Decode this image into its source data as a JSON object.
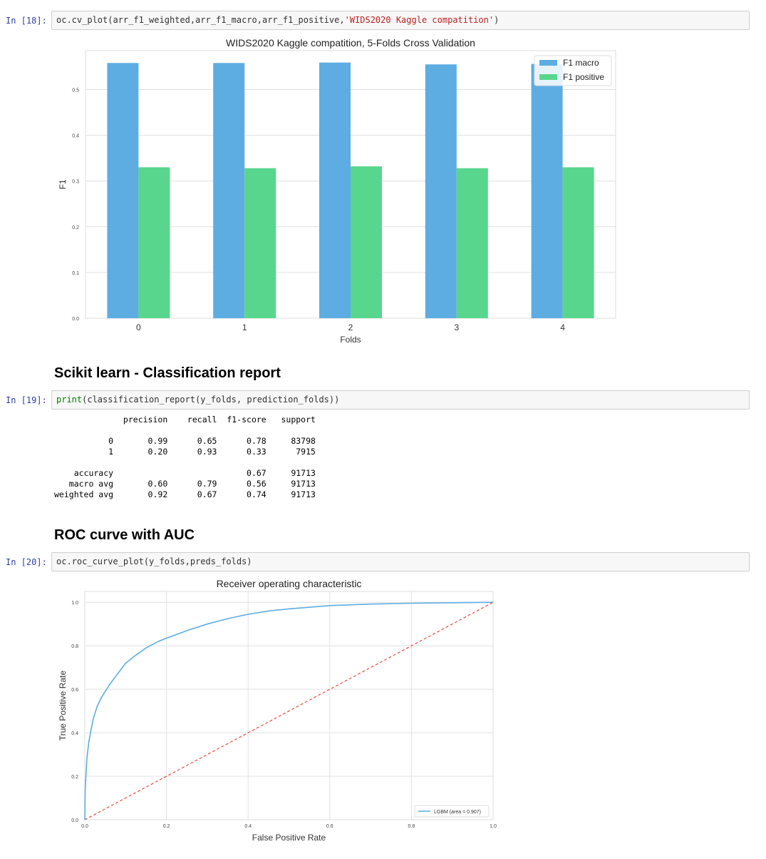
{
  "cells": [
    {
      "prompt": "In [18]:",
      "code_prefix": "oc.cv_plot(arr_f1_weighted,arr_f1_macro,arr_f1_positive,",
      "code_string": "'WIDS2020 Kaggle compatition'",
      "code_suffix": ")"
    },
    {
      "prompt": "In [19]:",
      "code_kw": "print",
      "code_rest": "(classification_report(y_folds, prediction_folds))"
    },
    {
      "prompt": "In [20]:",
      "code": "oc.roc_curve_plot(y_folds,preds_folds)"
    }
  ],
  "headings": {
    "classification": "Scikit learn - Classification report",
    "roc": "ROC curve with AUC"
  },
  "report_text": "              precision    recall  f1-score   support\n\n           0       0.99      0.65      0.78     83798\n           1       0.20      0.93      0.33      7915\n\n    accuracy                           0.67     91713\n   macro avg       0.60      0.79      0.56     91713\nweighted avg       0.92      0.67      0.74     91713",
  "colors": {
    "macro": "#5dade2",
    "positive": "#58d68d",
    "roc": "#5dade2",
    "diag": "#e74c3c",
    "grid": "#e0e0e0"
  },
  "chart_data": [
    {
      "type": "bar",
      "title": "WIDS2020 Kaggle compatition, 5-Folds Cross Validation",
      "xlabel": "Folds",
      "ylabel": "F1",
      "categories": [
        "0",
        "1",
        "2",
        "3",
        "4"
      ],
      "ylim": [
        0,
        0.585
      ],
      "yticks": [
        "0.0",
        "0.1",
        "0.2",
        "0.3",
        "0.4",
        "0.5"
      ],
      "legend": "top-right",
      "grid": true,
      "series": [
        {
          "name": "F1 macro",
          "values": [
            0.558,
            0.558,
            0.559,
            0.555,
            0.556
          ]
        },
        {
          "name": "F1 positive",
          "values": [
            0.33,
            0.328,
            0.332,
            0.328,
            0.33
          ]
        }
      ]
    },
    {
      "type": "line",
      "title": "Receiver operating characteristic",
      "xlabel": "False Positive Rate",
      "ylabel": "True Positive Rate",
      "xlim": [
        0,
        1.0
      ],
      "ylim": [
        0,
        1.05
      ],
      "xticks": [
        "0.0",
        "0.2",
        "0.4",
        "0.6",
        "0.8",
        "1.0"
      ],
      "yticks": [
        "0.0",
        "0.2",
        "0.4",
        "0.6",
        "0.8",
        "1.0"
      ],
      "legend": "bottom-right",
      "grid": true,
      "series": [
        {
          "name": "LGBM (area = 0.907)",
          "x": [
            0,
            0.001,
            0.005,
            0.01,
            0.02,
            0.03,
            0.04,
            0.06,
            0.08,
            0.1,
            0.12,
            0.15,
            0.18,
            0.2,
            0.25,
            0.3,
            0.35,
            0.4,
            0.45,
            0.5,
            0.6,
            0.7,
            0.8,
            0.9,
            1.0
          ],
          "y": [
            0,
            0.14,
            0.28,
            0.36,
            0.46,
            0.52,
            0.56,
            0.62,
            0.67,
            0.72,
            0.75,
            0.79,
            0.82,
            0.835,
            0.87,
            0.9,
            0.925,
            0.945,
            0.96,
            0.97,
            0.985,
            0.992,
            0.996,
            0.998,
            1.0
          ]
        },
        {
          "name": "",
          "x": [
            0,
            1.0
          ],
          "y": [
            0,
            1.0
          ],
          "style": "dashed"
        }
      ]
    }
  ]
}
